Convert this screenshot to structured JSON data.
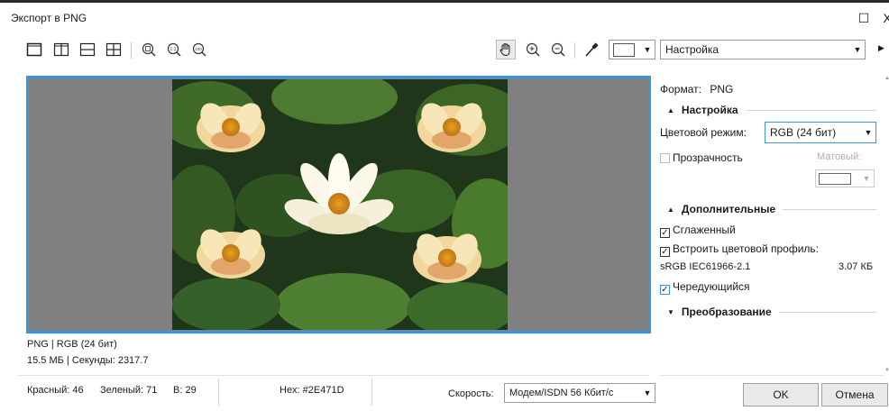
{
  "window": {
    "title": "Экспорт в PNG",
    "maximize_glyph": "☐",
    "close_glyph": "X"
  },
  "toolbar": {
    "preset_label": "Настройка",
    "icons": [
      "single-view-icon",
      "split-vertical-icon",
      "split-horizontal-icon",
      "quad-view-icon",
      "zoom-fit-icon",
      "zoom-1to1-icon",
      "zoom-100-icon",
      "pan-hand-icon",
      "zoom-in-icon",
      "zoom-out-icon",
      "eyedropper-icon",
      "color-swatch-icon"
    ]
  },
  "image_info": {
    "format_line": "PNG | RGB (24 бит)",
    "size_line": "15.5 МБ | Секунды: 2317.7"
  },
  "panel": {
    "format_label": "Формат:",
    "format_value": "PNG",
    "settings_section": "Настройка",
    "color_mode_label": "Цветовой режим:",
    "color_mode_value": "RGB (24 бит)",
    "transparency_label": "Прозрачность",
    "transparency_checked": false,
    "matte_label": "Матовый:",
    "additional_section": "Дополнительные",
    "antialiased_label": "Сглаженный",
    "antialiased_checked": true,
    "embed_profile_label": "Встроить цветовой профиль:",
    "embed_profile_checked": true,
    "profile_name": "sRGB IEC61966-2.1",
    "profile_size": "3.07 КБ",
    "interlaced_label": "Чередующийся",
    "interlaced_checked": true,
    "transform_section": "Преобразование"
  },
  "status": {
    "red": "Красный: 46",
    "green": "Зеленый: 71",
    "blue": "B: 29",
    "hex": "Hex: #2E471D",
    "speed_label": "Скорость:",
    "speed_value": "Модем/ISDN 56 Кбит/с"
  },
  "buttons": {
    "ok": "OK",
    "cancel": "Отмена"
  },
  "colors": {
    "accent": "#3a96dd",
    "preview_bg": "#808080",
    "sampled": "#2E471D"
  }
}
